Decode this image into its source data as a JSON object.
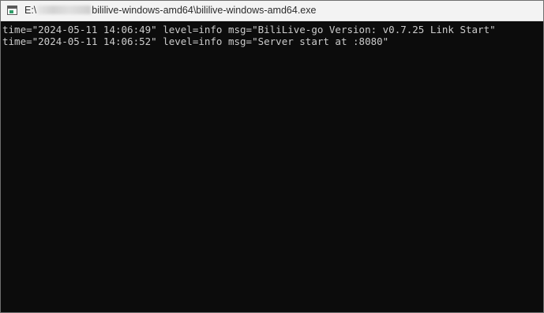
{
  "window": {
    "title_prefix": "E:\\",
    "title_suffix": "bililive-windows-amd64\\bililive-windows-amd64.exe",
    "icon": "console-window-icon"
  },
  "console": {
    "lines": [
      "time=\"2024-05-11 14:06:49\" level=info msg=\"BiliLive-go Version: v0.7.25 Link Start\"",
      "time=\"2024-05-11 14:06:52\" level=info msg=\"Server start at :8080\""
    ]
  },
  "colors": {
    "console_background": "#0c0c0c",
    "console_text": "#cccccc",
    "titlebar_background": "#f3f3f3"
  }
}
